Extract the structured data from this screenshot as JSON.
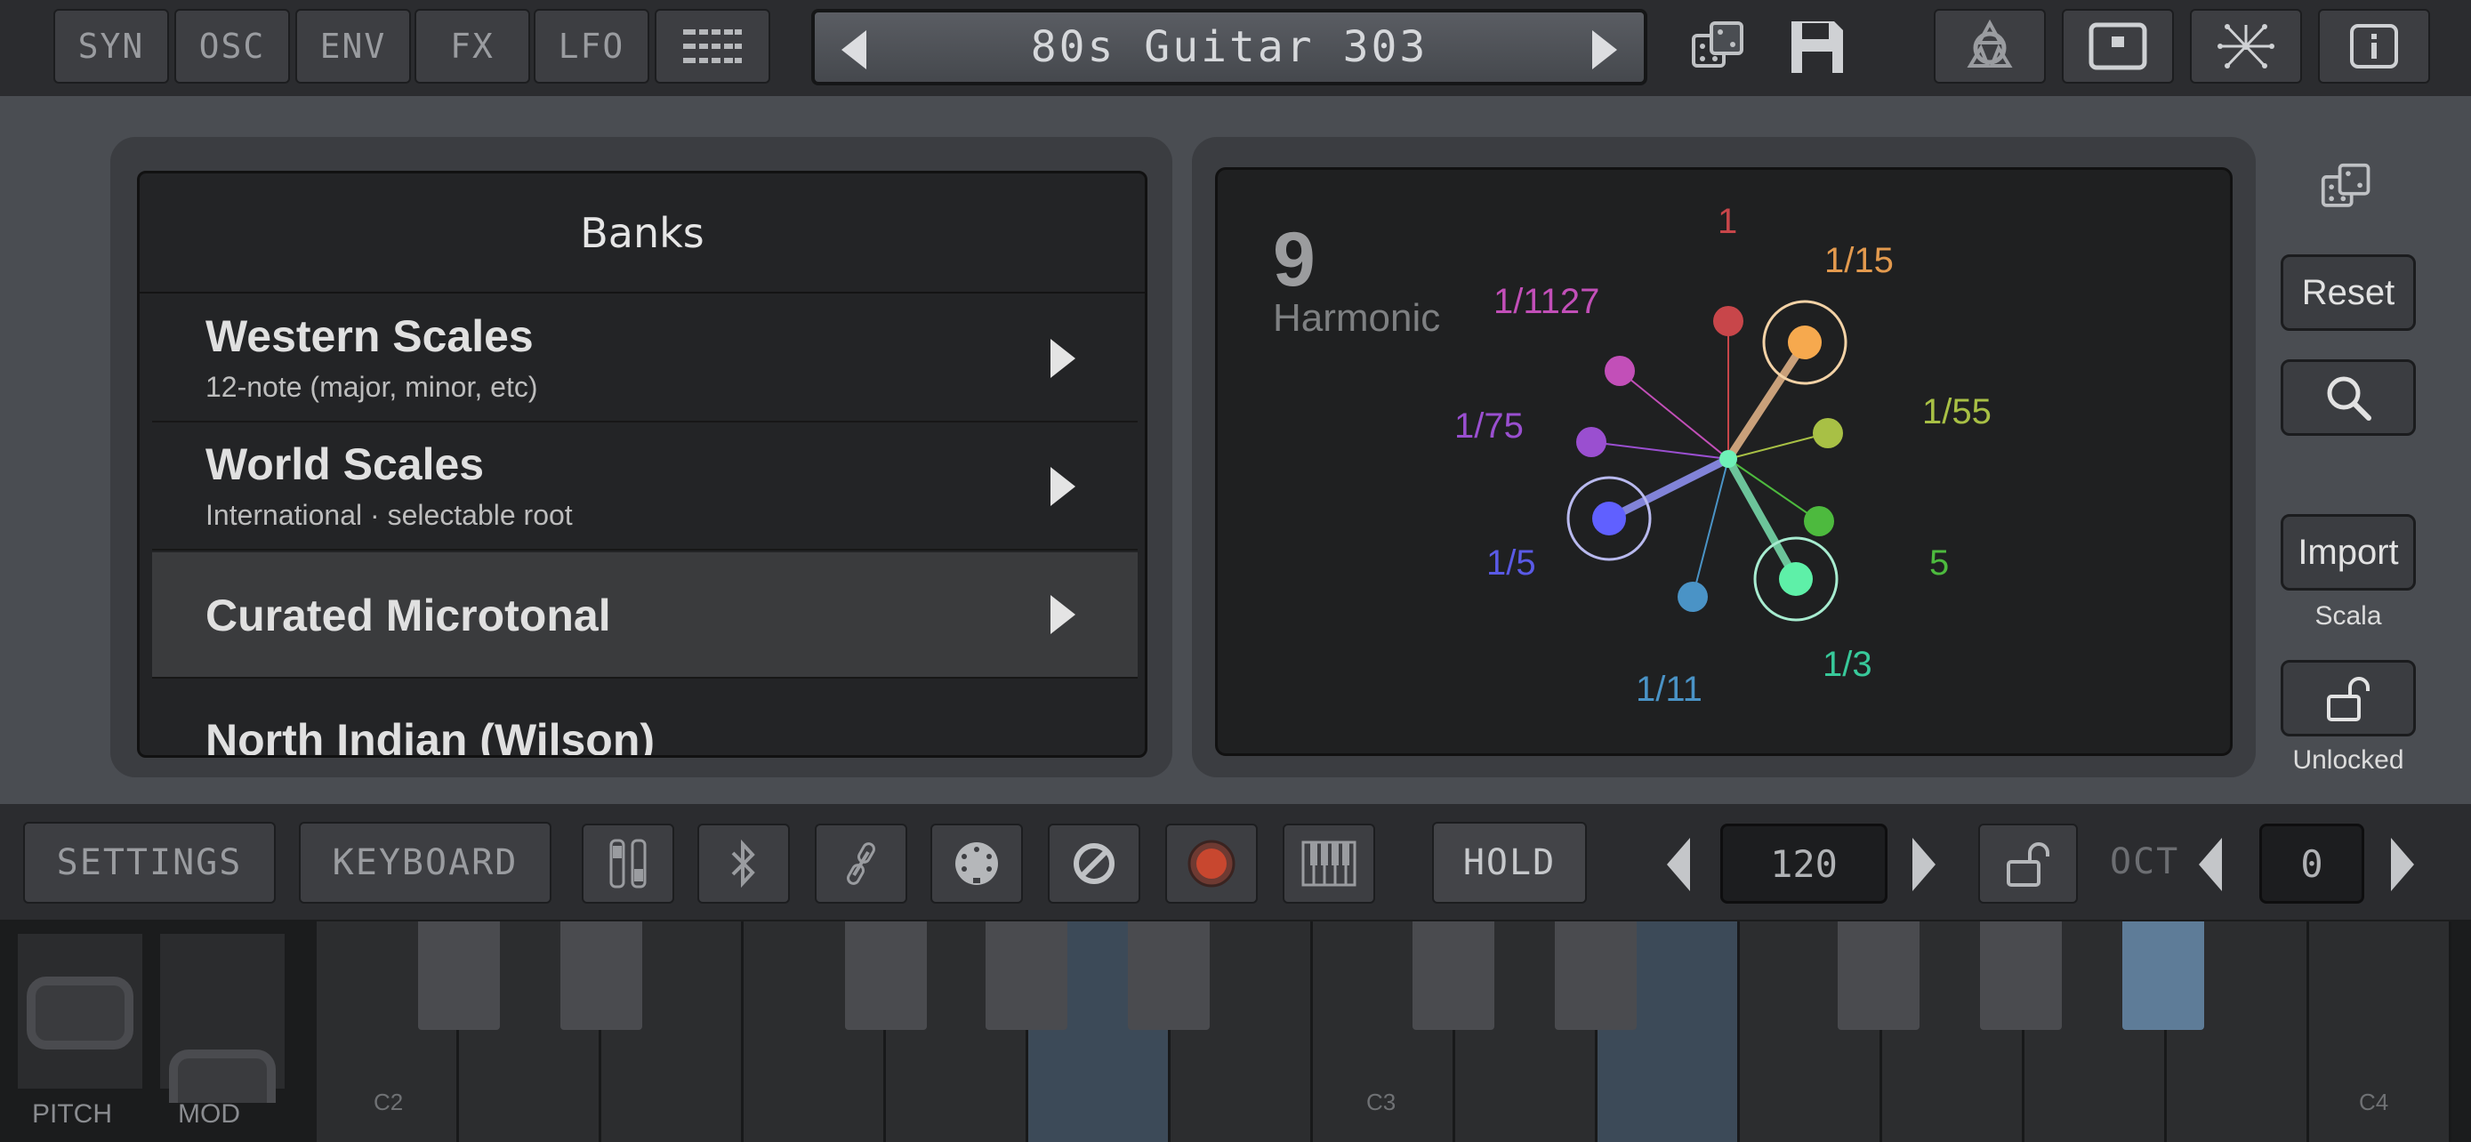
{
  "toolbar": {
    "tabs": [
      {
        "label": "SYN"
      },
      {
        "label": "OSC"
      },
      {
        "label": "ENV"
      },
      {
        "label": "FX"
      },
      {
        "label": "LFO"
      }
    ],
    "preset_name": "80s Guitar 303"
  },
  "banks": {
    "title": "Banks",
    "items": [
      {
        "name": "Western Scales",
        "subtitle": "12-note (major, minor, etc)"
      },
      {
        "name": "World Scales",
        "subtitle": "International · selectable root"
      },
      {
        "name": "Curated Microtonal",
        "subtitle": ""
      },
      {
        "name": "North Indian (Wilson)",
        "subtitle": ""
      }
    ],
    "selected_index": 2
  },
  "harmonic": {
    "count": "9",
    "label": "Harmonic",
    "ratios": [
      {
        "text": "1",
        "color": "#c8464a"
      },
      {
        "text": "1/15",
        "color": "#e39a4e"
      },
      {
        "text": "1/1127",
        "color": "#c24fb8"
      },
      {
        "text": "1/55",
        "color": "#a8c045"
      },
      {
        "text": "1/75",
        "color": "#9a4fd0"
      },
      {
        "text": "5",
        "color": "#4dba3e"
      },
      {
        "text": "1/5",
        "color": "#5a5ae6"
      },
      {
        "text": "1/3",
        "color": "#38c99a"
      },
      {
        "text": "1/11",
        "color": "#4a93c6"
      }
    ]
  },
  "side": {
    "reset": "Reset",
    "import": "Import",
    "import_sub": "Scala",
    "lock_label": "Unlocked"
  },
  "bottom": {
    "settings": "SETTINGS",
    "keyboard": "KEYBOARD",
    "hold": "HOLD",
    "tempo": "120",
    "oct_label": "OCT",
    "oct_value": "0"
  },
  "keyboard": {
    "labels": [
      "C2",
      "C3",
      "C4"
    ],
    "pitch": "PITCH",
    "mod": "MOD"
  },
  "icons": {
    "grid": "grid-icon",
    "dice": "dice-icon",
    "save": "save-icon",
    "midi": "midi-icon",
    "window": "window-icon",
    "network": "network-icon",
    "info": "info-icon",
    "search": "search-icon",
    "lock": "lock-icon",
    "bluetooth": "bluetooth-icon",
    "link": "link-icon",
    "din": "din-icon",
    "stop": "stop-icon",
    "record": "record-icon",
    "piano": "piano-icon"
  }
}
